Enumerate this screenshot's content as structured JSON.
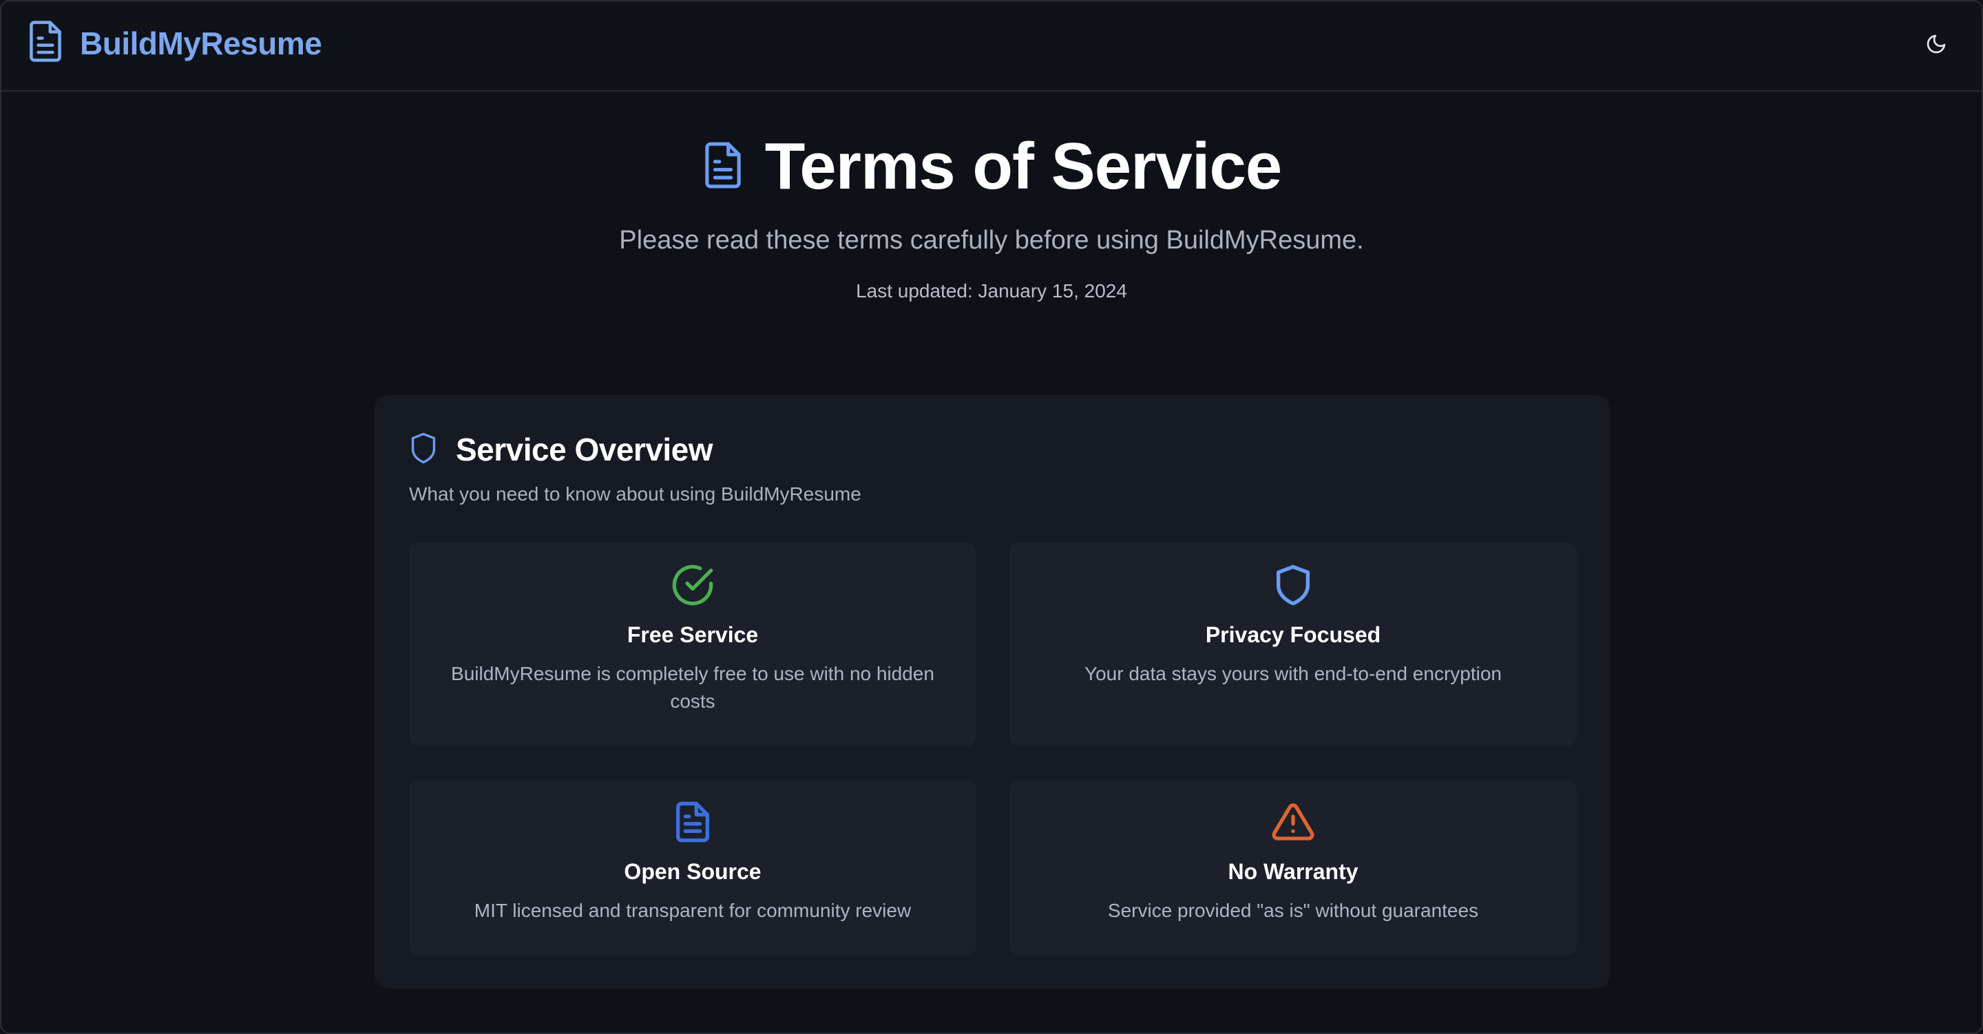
{
  "header": {
    "brand": "BuildMyResume",
    "brand_icon": "file-text-icon",
    "theme_toggle_icon": "moon-icon",
    "brand_color": "#7aa7ee"
  },
  "hero": {
    "title": "Terms of Service",
    "title_icon": "file-text-icon",
    "subtitle": "Please read these terms carefully before using BuildMyResume.",
    "last_updated": "Last updated: January 15, 2024"
  },
  "overview": {
    "title": "Service Overview",
    "title_icon": "shield-icon",
    "description": "What you need to know about using BuildMyResume",
    "items": [
      {
        "icon": "check-circle-icon",
        "color": "#4caf50",
        "title": "Free Service",
        "description": "BuildMyResume is completely free to use with no hidden costs"
      },
      {
        "icon": "shield-icon",
        "color": "#6a9cf2",
        "title": "Privacy Focused",
        "description": "Your data stays yours with end-to-end encryption"
      },
      {
        "icon": "file-text-icon",
        "color": "#3b6fe0",
        "title": "Open Source",
        "description": "MIT licensed and transparent for community review"
      },
      {
        "icon": "alert-triangle-icon",
        "color": "#e0642f",
        "title": "No Warranty",
        "description": "Service provided \"as is\" without guarantees"
      }
    ]
  }
}
